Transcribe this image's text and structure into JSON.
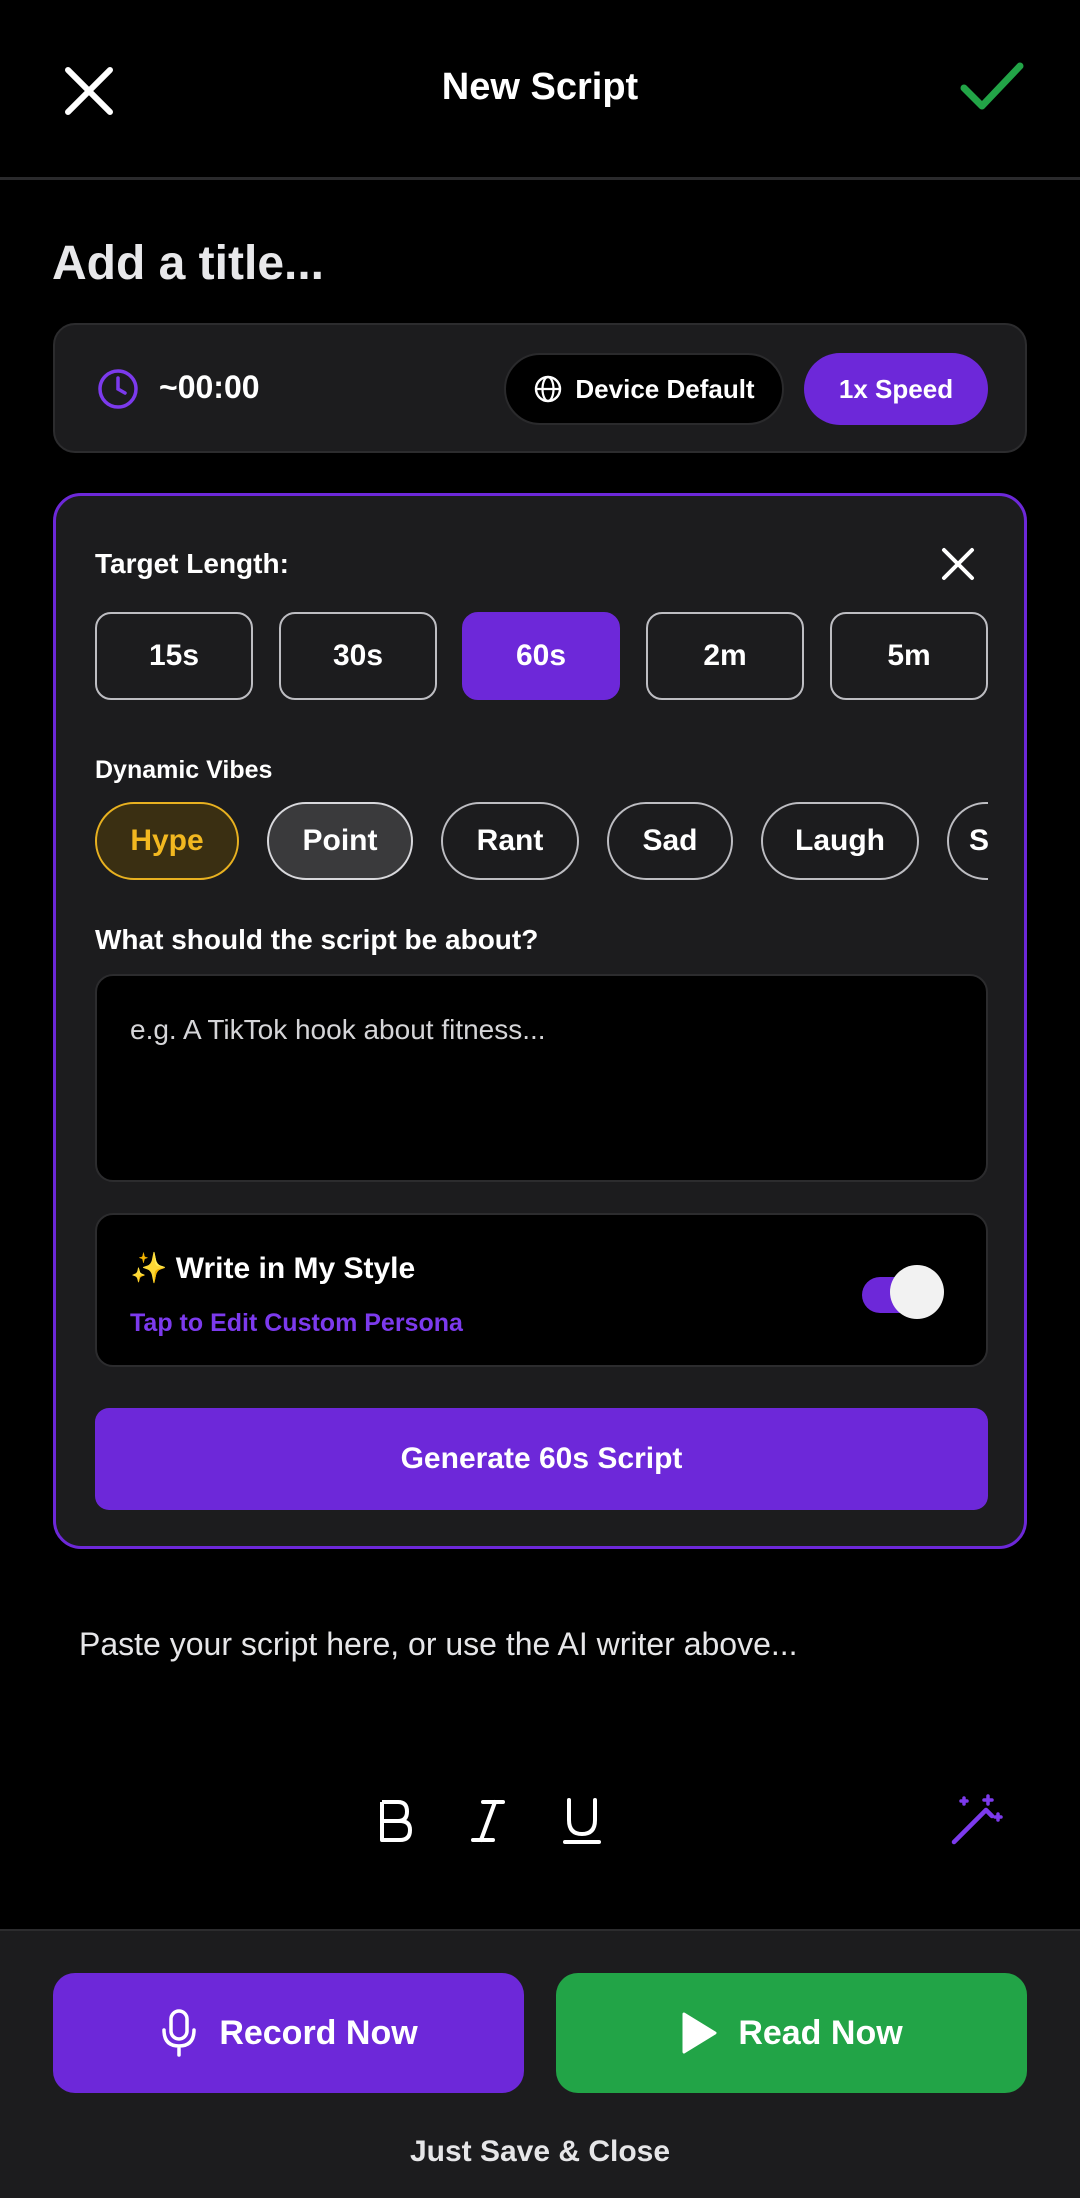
{
  "header": {
    "title": "New Script"
  },
  "title_placeholder": "Add a title...",
  "meta": {
    "duration": "~00:00",
    "voice": "Device Default",
    "speed": "1x Speed"
  },
  "ai_panel": {
    "target_label": "Target Length:",
    "lengths": [
      "15s",
      "30s",
      "60s",
      "2m",
      "5m"
    ],
    "selected_length": "60s",
    "vibes_label": "Dynamic Vibes",
    "vibes": [
      "Hype",
      "Point",
      "Rant",
      "Sad",
      "Laugh",
      "S"
    ],
    "topic_label": "What should the script be about?",
    "topic_placeholder": "e.g. A TikTok hook about fitness...",
    "style_title": "✨ Write in My Style",
    "style_sub": "Tap to Edit Custom Persona",
    "style_enabled": true,
    "generate_label": "Generate 60s Script"
  },
  "editor": {
    "placeholder": "Paste your script here, or use the AI writer above..."
  },
  "actions": {
    "record": "Record Now",
    "read": "Read Now",
    "save_close": "Just Save & Close"
  },
  "colors": {
    "accent": "#6d28d9",
    "green": "#22a447",
    "hype": "#f2b820"
  }
}
